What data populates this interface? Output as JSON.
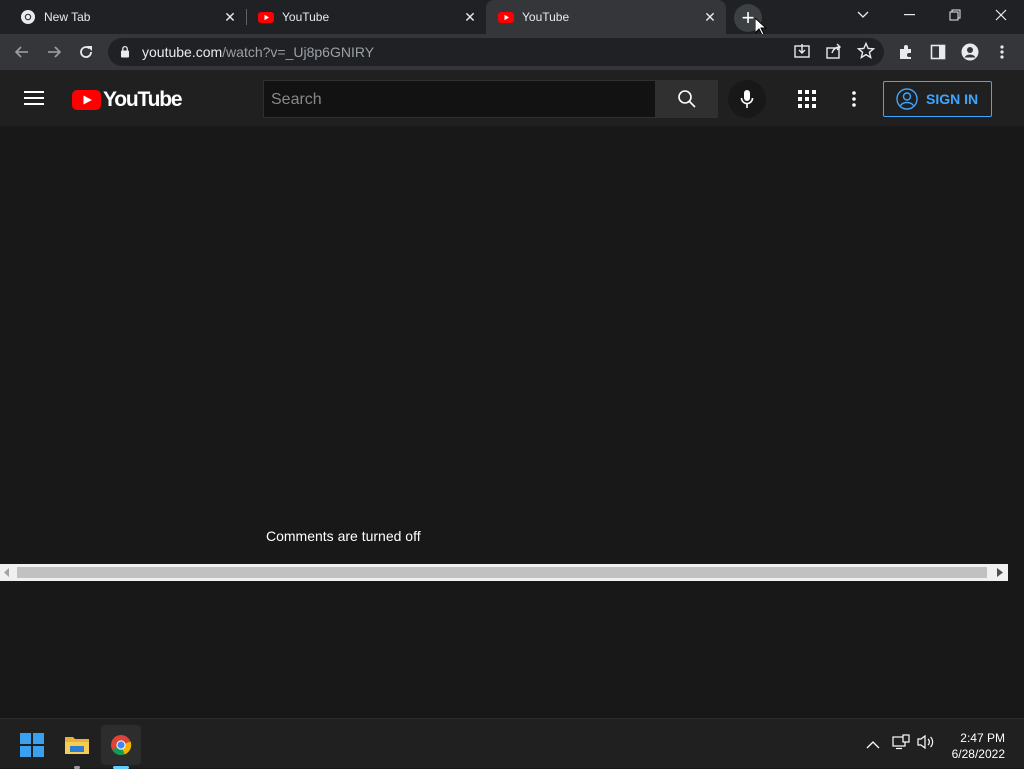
{
  "browser": {
    "tabs": [
      {
        "title": "New Tab",
        "icon": "chrome-icon"
      },
      {
        "title": "YouTube",
        "icon": "youtube-icon"
      },
      {
        "title": "YouTube",
        "icon": "youtube-icon",
        "active": true
      }
    ],
    "url_host": "youtube.com",
    "url_rest": "/watch?v=_Uj8p6GNIRY"
  },
  "youtube": {
    "logo_text": "YouTube",
    "search_placeholder": "Search",
    "sign_in_label": "SIGN IN",
    "comments_status": "Comments are turned off"
  },
  "taskbar": {
    "time": "2:47 PM",
    "date": "6/28/2022"
  },
  "colors": {
    "accent_blue": "#3ea6ff",
    "youtube_red": "#ff0000"
  }
}
